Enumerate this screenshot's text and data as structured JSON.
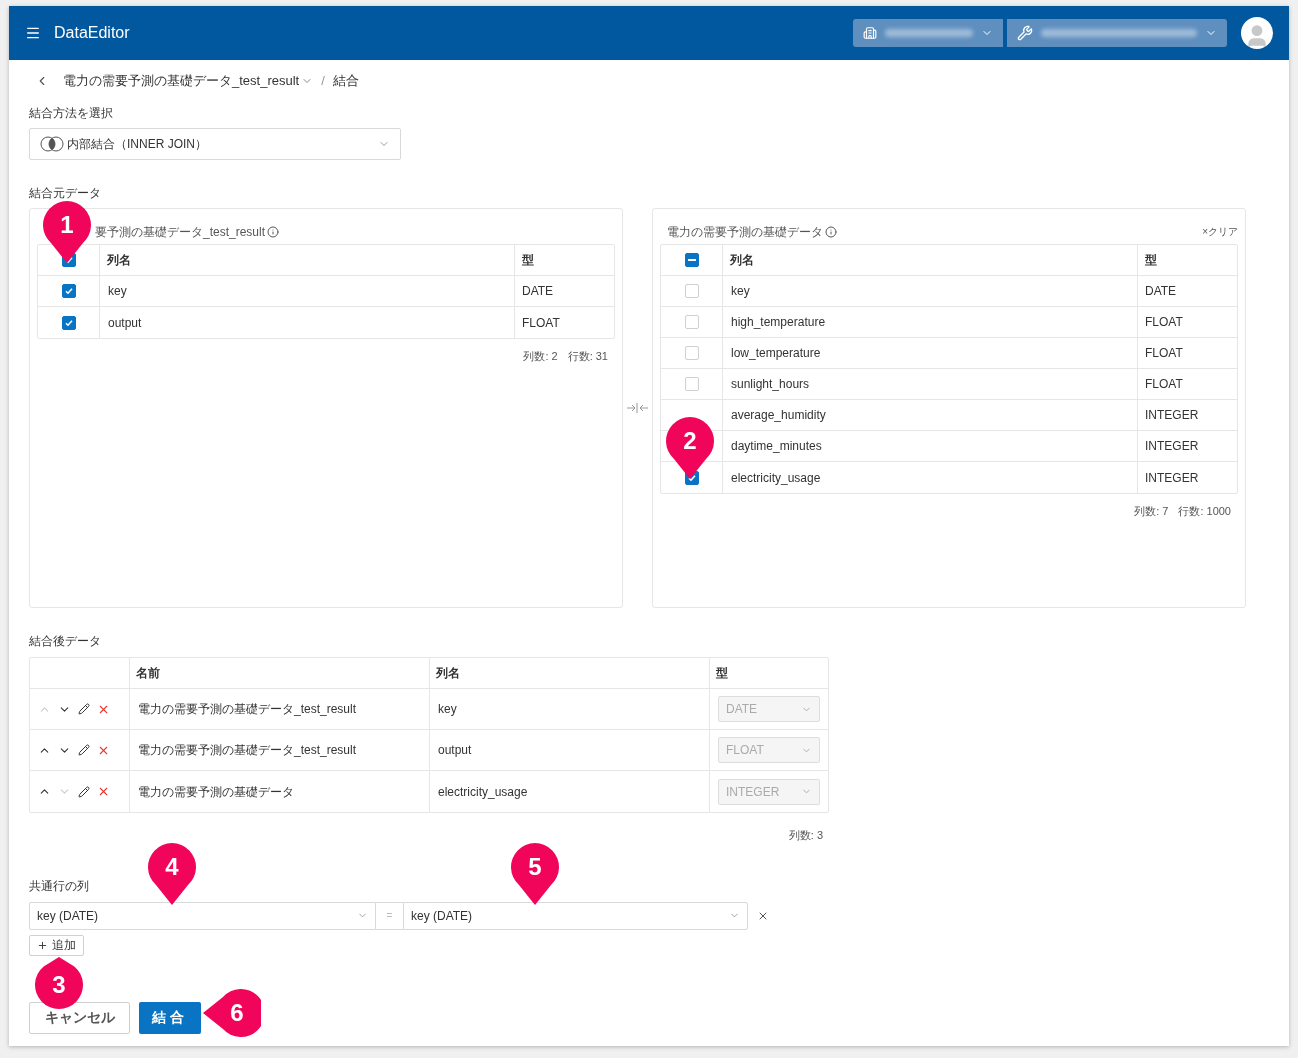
{
  "header": {
    "app_title": "DataEditor"
  },
  "breadcrumb": {
    "dataset": "電力の需要予測の基礎データ_test_result",
    "separator": "/",
    "current": "結合"
  },
  "join_method": {
    "label": "結合方法を選択",
    "value": "内部結合（INNER JOIN）"
  },
  "source_label": "結合元データ",
  "left_table": {
    "title": "要予測の基礎データ_test_result",
    "columns": [
      "列名",
      "型"
    ],
    "header_check": {
      "checked": true
    },
    "rows": [
      {
        "name": "key",
        "type": "DATE",
        "checked": true
      },
      {
        "name": "output",
        "type": "FLOAT",
        "checked": true
      }
    ],
    "summary": [
      "列数: 2",
      "行数: 31"
    ]
  },
  "right_table": {
    "title": "電力の需要予測の基礎データ",
    "clear": "×クリア",
    "columns": [
      "列名",
      "型"
    ],
    "header_check": {
      "indeterminate": true
    },
    "rows": [
      {
        "name": "key",
        "type": "DATE",
        "checked": false
      },
      {
        "name": "high_temperature",
        "type": "FLOAT",
        "checked": false
      },
      {
        "name": "low_temperature",
        "type": "FLOAT",
        "checked": false
      },
      {
        "name": "sunlight_hours",
        "type": "FLOAT",
        "checked": false
      },
      {
        "name": "average_humidity",
        "type": "INTEGER"
      },
      {
        "name": "daytime_minutes",
        "type": "INTEGER"
      },
      {
        "name": "electricity_usage",
        "type": "INTEGER",
        "checked": true
      }
    ],
    "summary": [
      "列数: 7",
      "行数: 1000"
    ]
  },
  "result": {
    "label": "結合後データ",
    "columns": [
      "名前",
      "列名",
      "型"
    ],
    "rows": [
      {
        "name": "電力の需要予測の基礎データ_test_result",
        "column": "key",
        "type": "DATE",
        "up_disabled": true,
        "down_disabled": false
      },
      {
        "name": "電力の需要予測の基礎データ_test_result",
        "column": "output",
        "type": "FLOAT",
        "up_disabled": false,
        "down_disabled": false
      },
      {
        "name": "電力の需要予測の基礎データ",
        "column": "electricity_usage",
        "type": "INTEGER",
        "up_disabled": false,
        "down_disabled": true
      }
    ],
    "summary": "列数: 3"
  },
  "keys": {
    "label": "共通行の列",
    "pairs": [
      {
        "left": "key (DATE)",
        "equals": "=",
        "right": "key (DATE)"
      }
    ],
    "add": "追加"
  },
  "buttons": {
    "cancel": "キャンセル",
    "submit": "結合"
  },
  "callouts": [
    {
      "number": "1",
      "kind": "down"
    },
    {
      "number": "2",
      "kind": "down"
    },
    {
      "number": "3",
      "kind": "up"
    },
    {
      "number": "4",
      "kind": "down"
    },
    {
      "number": "5",
      "kind": "down"
    },
    {
      "number": "6",
      "kind": "left"
    }
  ]
}
